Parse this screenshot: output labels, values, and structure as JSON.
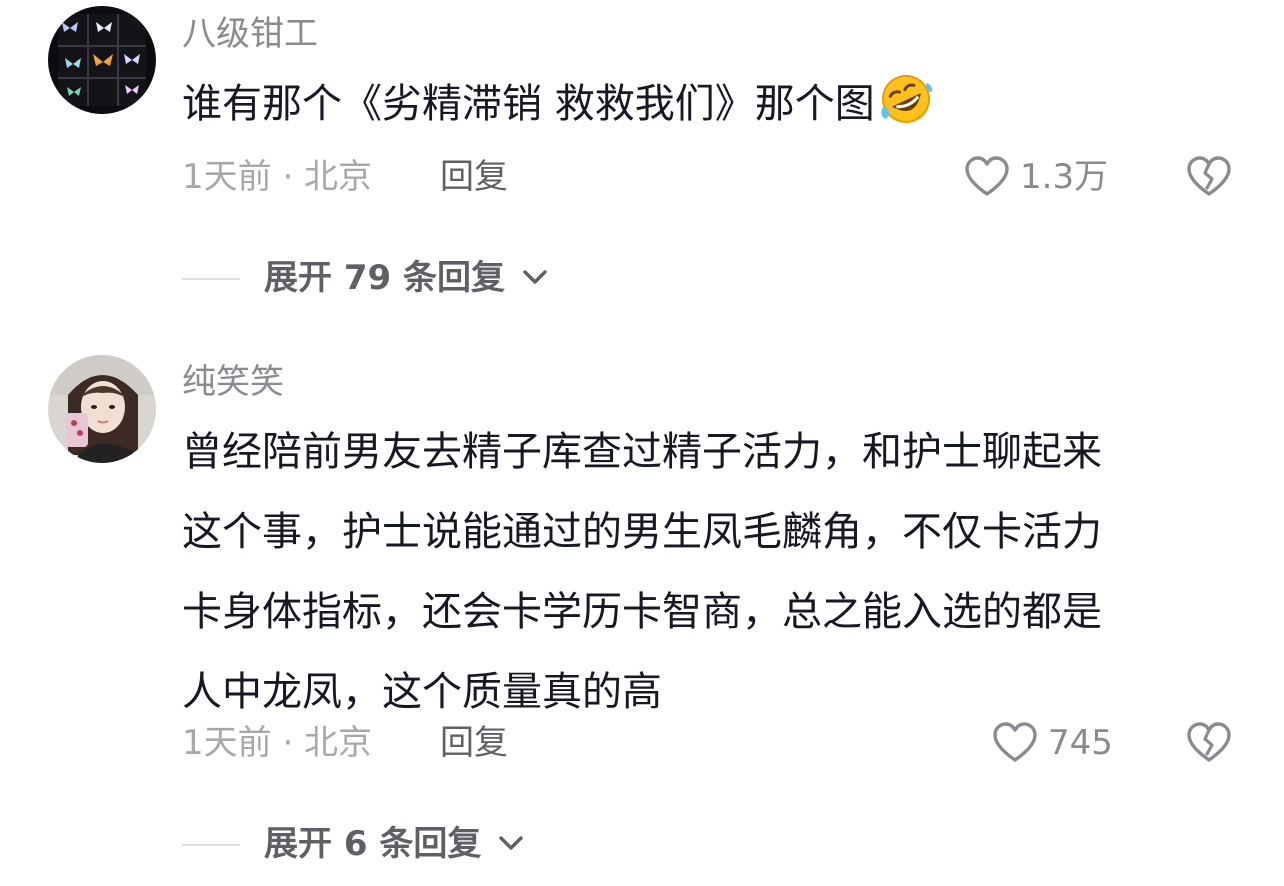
{
  "comments": [
    {
      "username": "八级钳工",
      "text": "谁有那个《劣精滞销 救救我们》那个图",
      "emoji": "rolling-on-floor-laughing-emoji",
      "meta": "1天前 · 北京",
      "reply": "回复",
      "likes": "1.3万",
      "expand": "展开 79 条回复"
    },
    {
      "username": "纯笑笑",
      "text": "曾经陪前男友去精子库查过精子活力，和护士聊起来\n这个事，护士说能通过的男生凤毛麟角，不仅卡活力\n卡身体指标，还会卡学历卡智商，总之能入选的都是\n人中龙凤，这个质量真的高",
      "meta": "1天前 · 北京",
      "reply": "回复",
      "likes": "745",
      "expand": "展开 6 条回复"
    }
  ],
  "icons": {
    "like": "heart-outline-icon",
    "dislike": "broken-heart-icon",
    "expand": "chevron-down-icon"
  },
  "colors": {
    "username": "#8a8b91",
    "text": "#161823",
    "meta": "#a7a8ad",
    "action": "#5f6066"
  }
}
